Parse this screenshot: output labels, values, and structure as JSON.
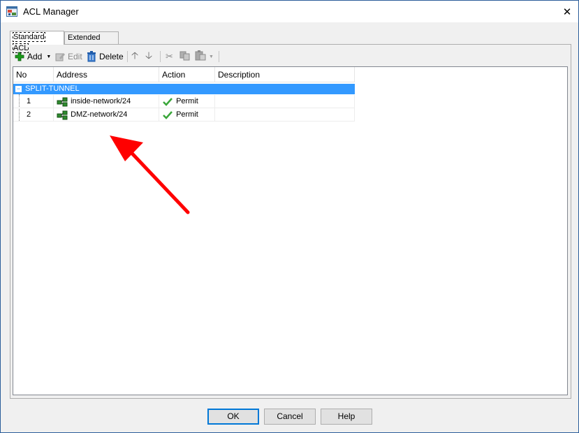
{
  "window": {
    "title": "ACL Manager",
    "close_glyph": "✕"
  },
  "tabs": [
    {
      "label": "Standard ACL",
      "active": true
    },
    {
      "label": "Extended ACL",
      "active": false
    }
  ],
  "toolbar": {
    "add_label": "Add",
    "edit_label": "Edit",
    "delete_label": "Delete"
  },
  "table": {
    "columns": [
      "No",
      "Address",
      "Action",
      "Description"
    ],
    "group": {
      "name": "SPLIT-TUNNEL",
      "toggle_glyph": "−"
    },
    "rows": [
      {
        "no": "1",
        "address": "inside-network/24",
        "action": "Permit",
        "description": ""
      },
      {
        "no": "2",
        "address": "DMZ-network/24",
        "action": "Permit",
        "description": ""
      }
    ]
  },
  "buttons": {
    "ok": "OK",
    "cancel": "Cancel",
    "help": "Help"
  },
  "colors": {
    "selection": "#3399ff",
    "annotation_arrow": "#ff0000",
    "add_icon": "#1a9a1a",
    "permit_check": "#3aa63a"
  },
  "icons": [
    "app-acl-icon",
    "close-icon",
    "add-icon",
    "edit-icon",
    "delete-icon",
    "move-up-icon",
    "move-down-icon",
    "cut-icon",
    "copy-icon",
    "paste-icon",
    "network-object-icon",
    "check-icon"
  ]
}
